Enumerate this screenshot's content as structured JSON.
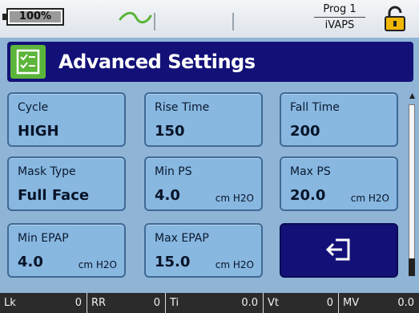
{
  "status": {
    "battery_label": "100%",
    "battery_level": 1.0,
    "program_line1": "Prog 1",
    "program_line2": "iVAPS",
    "lock_icon": "padlock-icon",
    "wave_icon": "breath-wave-icon",
    "wave_color": "#5bb53a",
    "lock_color": "#f2b705"
  },
  "title": {
    "text": "Advanced Settings",
    "icon": "settings-checklist-icon",
    "icon_color": "#5bb53a",
    "bar_color": "#131177"
  },
  "tiles": [
    {
      "label": "Cycle",
      "value": "HIGH",
      "unit": ""
    },
    {
      "label": "Rise Time",
      "value": "150",
      "unit": ""
    },
    {
      "label": "Fall Time",
      "value": "200",
      "unit": ""
    },
    {
      "label": "Mask Type",
      "value": "Full Face",
      "unit": ""
    },
    {
      "label": "Min PS",
      "value": "4.0",
      "unit": "cm H2O"
    },
    {
      "label": "Max PS",
      "value": "20.0",
      "unit": "cm H2O"
    },
    {
      "label": "Min EPAP",
      "value": "4.0",
      "unit": "cm H2O"
    },
    {
      "label": "Max EPAP",
      "value": "15.0",
      "unit": "cm H2O"
    }
  ],
  "back_button": {
    "icon": "exit-back-icon"
  },
  "bottom": [
    {
      "key": "Lk",
      "value": "0"
    },
    {
      "key": "RR",
      "value": "0"
    },
    {
      "key": "Ti",
      "value": "0.0"
    },
    {
      "key": "Vt",
      "value": "0"
    },
    {
      "key": "MV",
      "value": "0.0"
    }
  ]
}
